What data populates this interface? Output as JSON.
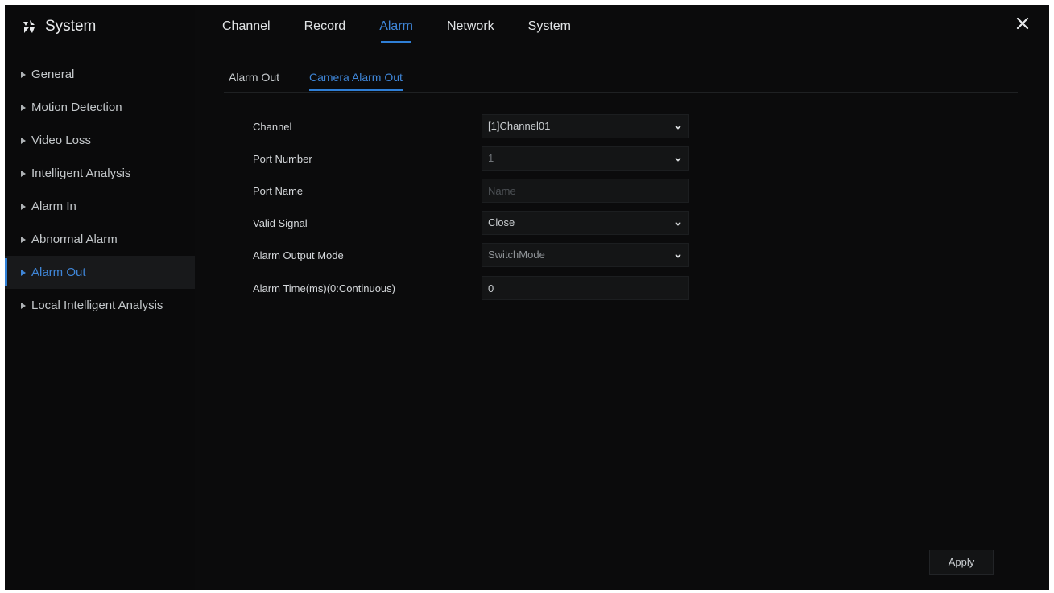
{
  "app": {
    "title": "System"
  },
  "topnav": {
    "tabs": [
      {
        "label": "Channel"
      },
      {
        "label": "Record"
      },
      {
        "label": "Alarm"
      },
      {
        "label": "Network"
      },
      {
        "label": "System"
      }
    ],
    "active_index": 2
  },
  "sidebar": {
    "items": [
      {
        "label": "General"
      },
      {
        "label": "Motion Detection"
      },
      {
        "label": "Video Loss"
      },
      {
        "label": "Intelligent Analysis"
      },
      {
        "label": "Alarm In"
      },
      {
        "label": "Abnormal Alarm"
      },
      {
        "label": "Alarm Out"
      },
      {
        "label": "Local Intelligent Analysis"
      }
    ],
    "active_index": 6
  },
  "subtabs": [
    {
      "label": "Alarm Out"
    },
    {
      "label": "Camera Alarm Out"
    }
  ],
  "form": {
    "channel": {
      "label": "Channel",
      "value": "[1]Channel01"
    },
    "port_number": {
      "label": "Port Number",
      "value": "1"
    },
    "port_name": {
      "label": "Port Name",
      "placeholder": "Name"
    },
    "valid_signal": {
      "label": "Valid Signal",
      "value": "Close"
    },
    "alarm_output_mode": {
      "label": "Alarm Output Mode",
      "value": "SwitchMode"
    },
    "alarm_time": {
      "label": "Alarm Time(ms)(0:Continuous)",
      "value": "0"
    }
  },
  "actions": {
    "apply_label": "Apply"
  },
  "colors": {
    "background": "#0b0b0c",
    "accent": "#2f7fd6",
    "text": "#cfd3d6"
  },
  "icons": {
    "logo": "system-logo-icon",
    "close": "close-icon",
    "dropdown": "chevron-down-icon",
    "bullet": "triangle-right-icon"
  }
}
